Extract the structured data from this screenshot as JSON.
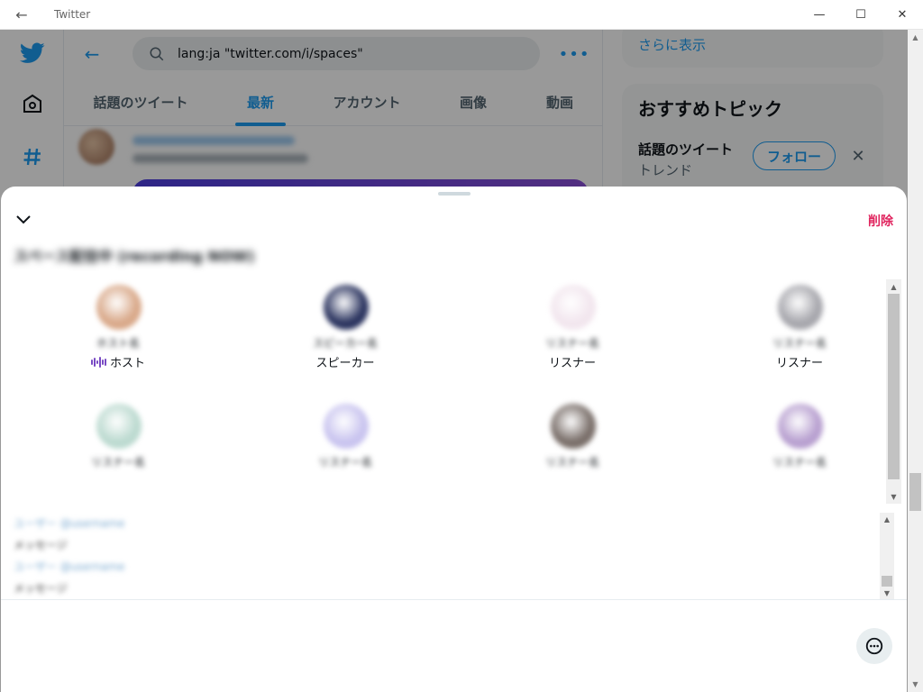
{
  "window": {
    "title": "Twitter",
    "back_glyph": "←",
    "minimize_glyph": "—",
    "maximize_glyph": "☐",
    "close_glyph": "✕"
  },
  "nav": {
    "icons": [
      "twitter-logo-icon",
      "home-icon",
      "explore-hashtag-icon"
    ]
  },
  "search": {
    "back_glyph": "←",
    "query": "lang:ja \"twitter.com/i/spaces\"",
    "more_glyph": "•••"
  },
  "tabs": [
    {
      "label": "話題のツイート",
      "active": false
    },
    {
      "label": "最新",
      "active": true
    },
    {
      "label": "アカウント",
      "active": false
    },
    {
      "label": "画像",
      "active": false
    },
    {
      "label": "動画",
      "active": false
    }
  ],
  "sidebar": {
    "show_more": "さらに表示",
    "topics_title": "おすすめトピック",
    "topic": {
      "name": "話題のツイート",
      "category": "トレンド",
      "follow_label": "フォロー",
      "dismiss_glyph": "✕"
    }
  },
  "sheet": {
    "delete_label": "削除",
    "space_title": "スペース配信中 (recording NOW)",
    "people": [
      {
        "role": "ホスト",
        "name": "ホスト名",
        "is_host": true,
        "avatar_color": "#d9a98a"
      },
      {
        "role": "スピーカー",
        "name": "スピーカー名",
        "is_host": false,
        "avatar_color": "#2c3560"
      },
      {
        "role": "リスナー",
        "name": "リスナー名",
        "is_host": false,
        "avatar_color": "#f2e6ee"
      },
      {
        "role": "リスナー",
        "name": "リスナー名",
        "is_host": false,
        "avatar_color": "#a7a7ad"
      },
      {
        "role": "",
        "name": "リスナー名",
        "is_host": false,
        "avatar_color": "#bcdad0"
      },
      {
        "role": "",
        "name": "リスナー名",
        "is_host": false,
        "avatar_color": "#c9c4ef"
      },
      {
        "role": "",
        "name": "リスナー名",
        "is_host": false,
        "avatar_color": "#7a6f6a"
      },
      {
        "role": "",
        "name": "リスナー名",
        "is_host": false,
        "avatar_color": "#b8a0d0"
      }
    ],
    "chat": [
      {
        "user": "ユーザー @username",
        "text": ""
      },
      {
        "user": "",
        "text": "メッセージ"
      },
      {
        "user": "ユーザー @username",
        "text": ""
      },
      {
        "user": "",
        "text": "メッセージ"
      }
    ]
  },
  "colors": {
    "accent": "#1d9bf0",
    "danger": "#e0245e",
    "host_purple": "#794bc4"
  }
}
